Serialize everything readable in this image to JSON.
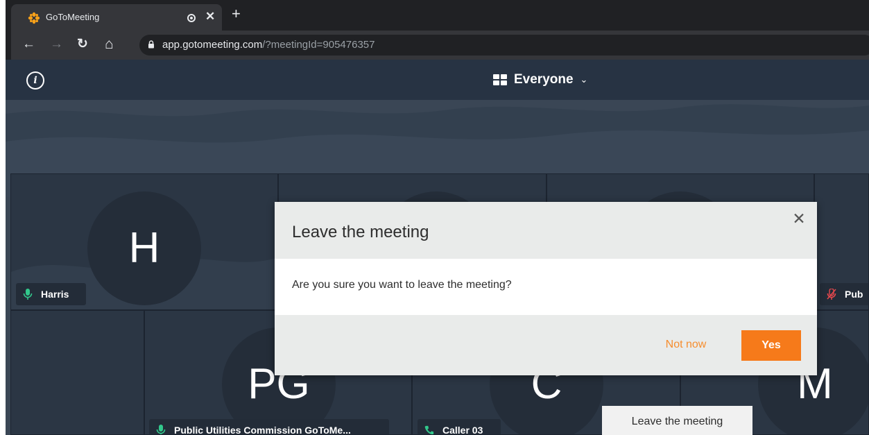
{
  "browser": {
    "tab_title": "GoToMeeting",
    "tab_close_glyph": "✕",
    "new_tab_glyph": "+",
    "back_glyph": "←",
    "forward_glyph": "→",
    "reload_glyph": "↻",
    "home_glyph": "⌂",
    "url_host": "app.gotomeeting.com",
    "url_rest": "/?meetingId=905476357"
  },
  "header": {
    "info_glyph": "i",
    "view_label": "Everyone",
    "view_chevron": "⌄"
  },
  "participants": [
    {
      "initials": "H",
      "name": "Harris",
      "status": "mic-on"
    },
    {
      "initials": "",
      "name": "",
      "status": ""
    },
    {
      "initials": "",
      "name": "",
      "status": ""
    },
    {
      "initials": "",
      "name": "Pub",
      "status": "mic-muted"
    },
    {
      "initials": "PG",
      "name": "Public Utilities Commission GoToMe...",
      "status": "mic-on"
    },
    {
      "initials": "C",
      "name": "Caller 03",
      "status": "phone"
    },
    {
      "initials": "M",
      "name": "",
      "status": ""
    }
  ],
  "dialog": {
    "title": "Leave the meeting",
    "close_glyph": "✕",
    "message": "Are you sure you want to leave the meeting?",
    "secondary_label": "Not now",
    "primary_label": "Yes"
  },
  "tooltip": {
    "text": "Leave the meeting"
  },
  "colors": {
    "accent": "#f67a1a",
    "mic_on": "#32c88c",
    "mic_muted": "#e5484d",
    "phone": "#32c88c"
  },
  "icons": {
    "favicon": "gotomeeting-logo-icon",
    "lock": "lock-icon",
    "info": "info-icon",
    "view": "grid-icon",
    "mic_on": "microphone-icon",
    "mic_muted": "microphone-muted-icon",
    "phone": "phone-icon"
  }
}
